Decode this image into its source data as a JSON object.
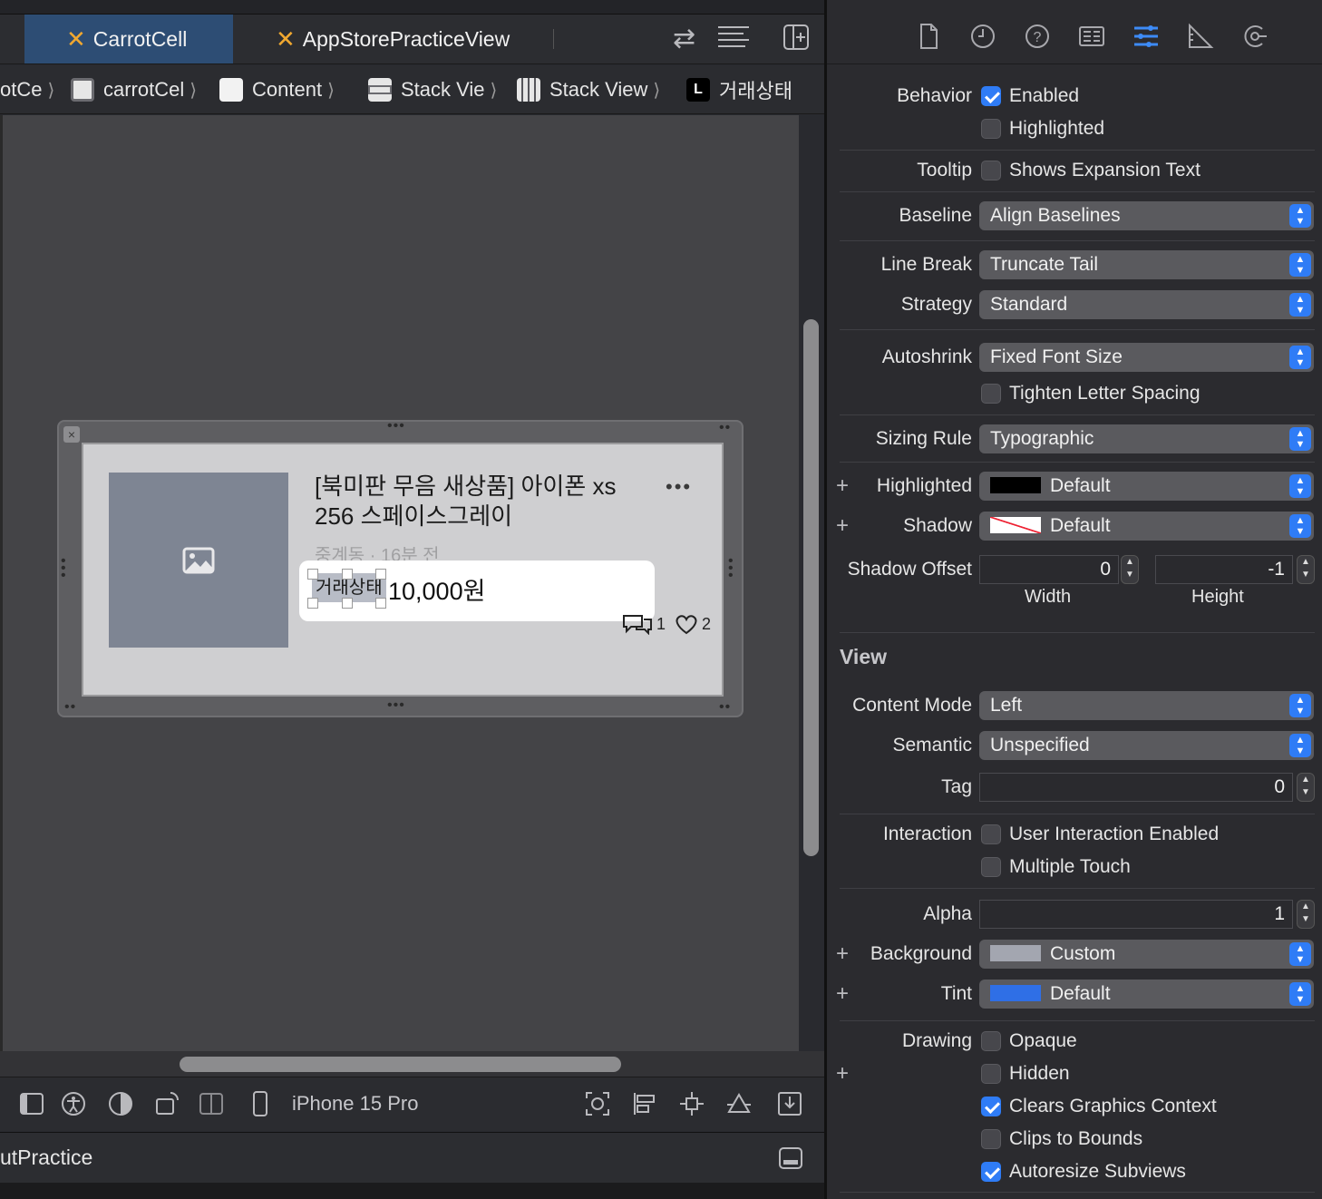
{
  "editor": {
    "tabs": [
      {
        "label": "CarrotCell",
        "active": true
      },
      {
        "label": "AppStorePracticeView",
        "active": false
      }
    ],
    "breadcrumbs": [
      "otCe",
      "carrotCel",
      "Content",
      "Stack Vie",
      "Stack View",
      "거래상태"
    ],
    "cell": {
      "title": "[북미판 무음 새상품] 아이폰 xs 256 스페이스그레이",
      "subtitle": "중계동 · 16분 전",
      "status": "거래상태",
      "price": "10,000원",
      "chat_count": "1",
      "like_count": "2",
      "more": "•••"
    },
    "device": "iPhone 15 Pro",
    "debug_title": "utPractice"
  },
  "inspector": {
    "behavior_label": "Behavior",
    "enabled_label": "Enabled",
    "enabled": true,
    "highlighted_cb_label": "Highlighted",
    "highlighted_cb": false,
    "tooltip_label": "Tooltip",
    "tooltip_text": "Shows Expansion Text",
    "baseline_label": "Baseline",
    "baseline": "Align Baselines",
    "linebreak_label": "Line Break",
    "linebreak": "Truncate Tail",
    "strategy_label": "Strategy",
    "strategy": "Standard",
    "autoshrink_label": "Autoshrink",
    "autoshrink": "Fixed Font Size",
    "tighten_label": "Tighten Letter Spacing",
    "sizing_label": "Sizing Rule",
    "sizing": "Typographic",
    "highlighted_label": "Highlighted",
    "highlighted": "Default",
    "shadow_label": "Shadow",
    "shadow": "Default",
    "shadow_offset_label": "Shadow Offset",
    "shadow_offset_width": "0",
    "shadow_offset_height": "-1",
    "width_label": "Width",
    "height_label": "Height",
    "view_section": "View",
    "content_mode_label": "Content Mode",
    "content_mode": "Left",
    "semantic_label": "Semantic",
    "semantic": "Unspecified",
    "tag_label": "Tag",
    "tag": "0",
    "interaction_label": "Interaction",
    "user_interaction_label": "User Interaction Enabled",
    "multiple_touch_label": "Multiple Touch",
    "alpha_label": "Alpha",
    "alpha": "1",
    "background_label": "Background",
    "background": "Custom",
    "tint_label": "Tint",
    "tint": "Default",
    "drawing_label": "Drawing",
    "opaque_label": "Opaque",
    "hidden_label": "Hidden",
    "clears_label": "Clears Graphics Context",
    "clips_label": "Clips to Bounds",
    "autoresize_label": "Autoresize Subviews",
    "colors": {
      "accent": "#2f7cf6",
      "highlighted_swatch": "#000000",
      "background_swatch": "#a3a6b0",
      "tint_swatch": "#2f6fe6",
      "tab_active_bg": "#2d4d74"
    }
  }
}
